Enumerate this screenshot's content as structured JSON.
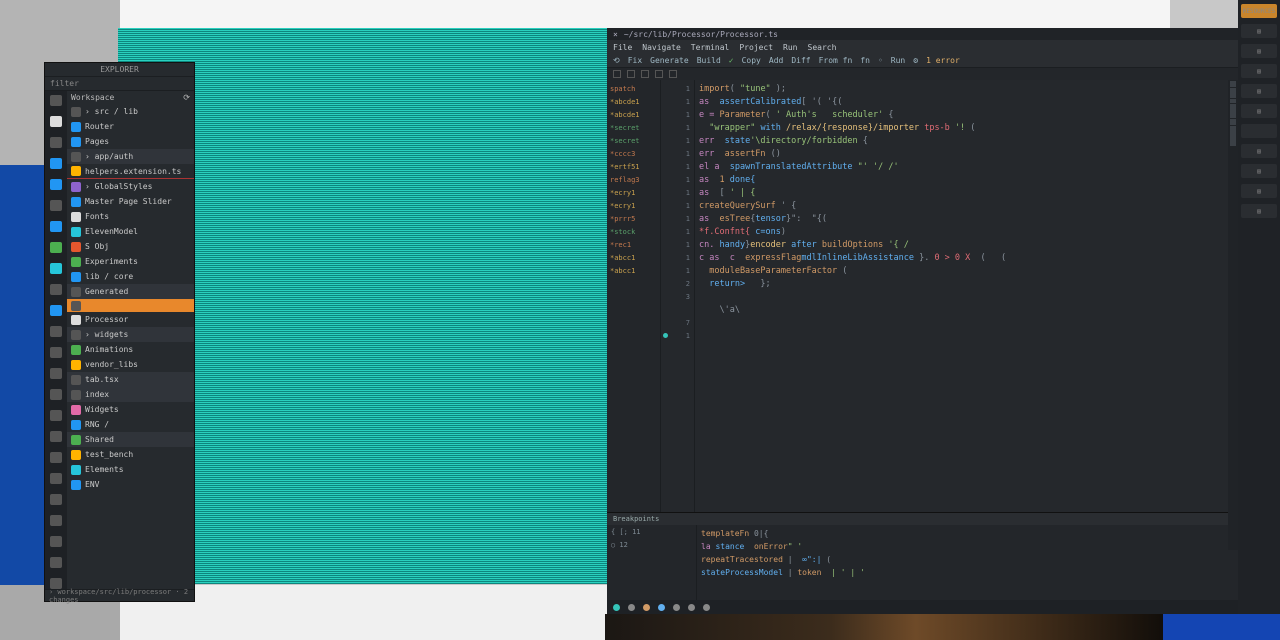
{
  "backdrop": {},
  "sidebar": {
    "title": "EXPLORER",
    "filter_placeholder": "filter",
    "tree_header": "Workspace",
    "items": [
      {
        "icon": "c-gy",
        "label": "› src / lib"
      },
      {
        "icon": "c-bl",
        "label": "Router"
      },
      {
        "icon": "c-bl",
        "label": "Pages"
      },
      {
        "icon": "c-gy",
        "label": "› app/auth",
        "variant": "dim"
      },
      {
        "icon": "c-yl",
        "label": "helpers.extension.ts",
        "variant": "err"
      },
      {
        "icon": "c-pu",
        "label": "› GlobalStyles"
      },
      {
        "icon": "c-bl",
        "label": "Master Page Slider"
      },
      {
        "icon": "c-wt",
        "label": "Fonts"
      },
      {
        "icon": "c-cy",
        "label": "ElevenModel"
      },
      {
        "icon": "c-rd",
        "label": "S Obj"
      },
      {
        "icon": "c-gr",
        "label": "Experiments"
      },
      {
        "icon": "c-bl",
        "label": "lib / core"
      },
      {
        "icon": "c-gy",
        "label": "Generated",
        "variant": "dim"
      },
      {
        "icon": "c-gy",
        "label": "",
        "variant": "sel"
      },
      {
        "icon": "c-wt",
        "label": "Processor"
      },
      {
        "icon": "c-gy",
        "label": "› widgets",
        "variant": "dim"
      },
      {
        "icon": "c-gr",
        "label": "Animations"
      },
      {
        "icon": "c-yl",
        "label": "vendor_libs"
      },
      {
        "icon": "c-gy",
        "label": "tab.tsx",
        "variant": "dim"
      },
      {
        "icon": "c-gy",
        "label": "index",
        "variant": "dim"
      },
      {
        "icon": "c-pk",
        "label": "Widgets"
      },
      {
        "icon": "c-bl",
        "label": "RNG /"
      },
      {
        "icon": "c-gr",
        "label": "Shared",
        "variant": "dim"
      },
      {
        "icon": "c-yl",
        "label": "test_bench"
      },
      {
        "icon": "c-cy",
        "label": "Elements"
      },
      {
        "icon": "c-bl",
        "label": "ENV"
      }
    ],
    "status": "› workspace/src/lib/processor · 2 changes"
  },
  "rail_icons": [
    "c-gy",
    "c-wt",
    "c-gy",
    "c-bl",
    "c-bl",
    "c-gy",
    "c-bl",
    "c-gr",
    "c-cy",
    "c-gy",
    "c-bl",
    "c-gy",
    "c-gy",
    "c-gy",
    "c-gy",
    "c-gy",
    "c-gy",
    "c-gy",
    "c-gy",
    "c-gy",
    "c-gy",
    "c-gy",
    "c-gy",
    "c-gy"
  ],
  "editor": {
    "tab_title": "~/src/lib/Processor/Processor.ts",
    "menus": [
      "File",
      "Navigate",
      "Terminal",
      "Project",
      "Run",
      "Search"
    ],
    "toolbar": [
      "⟲",
      "Fix",
      "Generate",
      "Build",
      "✓",
      "Copy",
      "Add",
      "Diff",
      "From fn",
      "fn",
      "◦",
      "Run",
      "⚙",
      "1 error"
    ],
    "breadcrumbs": [
      "□",
      "□",
      "□",
      "□",
      "□"
    ],
    "blame": [
      {
        "t": "spatch",
        "c": ""
      },
      {
        "t": "*abcde1",
        "c": "alt"
      },
      {
        "t": "*abcde1",
        "c": "alt"
      },
      {
        "t": "*secret",
        "c": "gr"
      },
      {
        "t": "*secret",
        "c": "gr"
      },
      {
        "t": "*cccc3",
        "c": ""
      },
      {
        "t": "*ertf51",
        "c": "alt"
      },
      {
        "t": "reflag3",
        "c": ""
      },
      {
        "t": "*ecry1",
        "c": "alt"
      },
      {
        "t": "*ecry1",
        "c": "alt"
      },
      {
        "t": "*prrr5",
        "c": ""
      },
      {
        "t": "*stock",
        "c": "gr"
      },
      {
        "t": "*rec1",
        "c": ""
      },
      {
        "t": "*abcc1",
        "c": "alt"
      },
      {
        "t": "*abcc1",
        "c": "alt"
      },
      {
        "t": "",
        "c": ""
      },
      {
        "t": "",
        "c": ""
      },
      {
        "t": "",
        "c": ""
      },
      {
        "t": "",
        "c": ""
      },
      {
        "t": "",
        "c": ""
      },
      {
        "t": "",
        "c": ""
      }
    ],
    "gutter": [
      "1",
      "1",
      "1",
      "1",
      "1",
      "1",
      "1",
      "1",
      "1",
      "1",
      "1",
      "1",
      "1",
      "1",
      "1",
      "2",
      "3",
      "",
      "7",
      "1",
      ""
    ],
    "gutter_marks": [
      19
    ],
    "code": [
      [
        [
          "tk-fn",
          "import"
        ],
        [
          "tk-punc",
          "( "
        ],
        [
          "tk-str",
          "\"tune\""
        ],
        [
          "tk-punc",
          " );"
        ]
      ],
      [
        [
          "tk-kw",
          "as  "
        ],
        [
          "tk-id",
          "assertCalibrated"
        ],
        [
          "tk-punc",
          "[ '( '{("
        ]
      ],
      [
        [
          "tk-kw",
          "e = "
        ],
        [
          "tk-fn",
          "Parameter"
        ],
        [
          "tk-punc",
          "( "
        ],
        [
          "tk-str",
          "' Auth's   scheduler'"
        ],
        [
          "tk-punc",
          " {"
        ]
      ],
      [
        [
          "tk-punc",
          "  "
        ],
        [
          "tk-str",
          "\"wrapper\" "
        ],
        [
          "tk-id",
          "with "
        ],
        [
          "tk-type",
          "/relax/{response}/importer "
        ],
        [
          "tk-err",
          "tps-b "
        ],
        [
          "tk-str",
          "'! "
        ],
        [
          "tk-punc",
          "("
        ]
      ],
      [
        [
          "tk-kw",
          "err  "
        ],
        [
          "tk-id",
          "state"
        ],
        [
          "tk-str",
          "'\\directory/forbidden "
        ],
        [
          "tk-punc",
          "{"
        ]
      ],
      [
        [
          "tk-kw",
          "err  "
        ],
        [
          "tk-fn",
          "assertFn "
        ],
        [
          "tk-punc",
          "()"
        ]
      ],
      [
        [
          "tk-kw",
          "el a  "
        ],
        [
          "tk-id",
          "spawnTranslatedAttribute "
        ],
        [
          "tk-str",
          "\"' '/ /'"
        ]
      ],
      [
        [
          "tk-kw",
          "as  "
        ],
        [
          "tk-num",
          "1 "
        ],
        [
          "tk-id",
          "done{"
        ]
      ],
      [
        [
          "tk-kw",
          "as  "
        ],
        [
          "tk-punc",
          "[ "
        ],
        [
          "tk-str",
          "' | {"
        ]
      ],
      [
        [
          "tk-fn",
          "createQuerySurf"
        ],
        [
          "tk-punc",
          " ' {"
        ]
      ],
      [
        [
          "tk-kw",
          "as  "
        ],
        [
          "tk-fn",
          "esTree"
        ],
        [
          "tk-punc",
          "{"
        ],
        [
          "tk-id",
          "tensor"
        ],
        [
          "tk-punc",
          "}\":  \"{("
        ]
      ],
      [
        [
          "tk-err",
          "*f.Confnt{ "
        ],
        [
          "tk-id",
          "c=ons"
        ],
        [
          "tk-punc",
          ")"
        ]
      ],
      [
        [
          "tk-kw",
          "cn. "
        ],
        [
          "tk-id",
          "handy"
        ],
        [
          "tk-punc",
          "}"
        ],
        [
          "tk-type",
          "encoder "
        ],
        [
          "tk-id",
          "after "
        ],
        [
          "tk-fn",
          "buildOptions "
        ],
        [
          "tk-str",
          "'{ /"
        ]
      ],
      [
        [
          "tk-kw",
          "c "
        ],
        [
          "tk-kw",
          "as  c  "
        ],
        [
          "tk-fn",
          "expressFlag"
        ],
        [
          "tk-id",
          "mdlInlineLibAssistance "
        ],
        [
          "tk-punc",
          "}. "
        ],
        [
          "tk-err",
          "0 > 0 X  "
        ],
        [
          "tk-punc",
          "(   ("
        ]
      ],
      [
        [
          "tk-fn",
          "  moduleBaseParameterFactor "
        ],
        [
          "tk-punc",
          "("
        ]
      ],
      [
        [
          "tk-id",
          "  return> "
        ],
        [
          "tk-punc",
          "  };"
        ]
      ],
      [
        []
      ],
      [
        [
          "tk-punc",
          "    \\'a\\"
        ]
      ],
      [
        []
      ],
      [
        []
      ],
      [
        []
      ]
    ],
    "terminal": {
      "tab": "Breakpoints",
      "gut": [
        "{ [; ",
        "○",
        "",
        ""
      ],
      "gut_nums": [
        "11",
        "12",
        "",
        ""
      ],
      "lines": [
        [
          [
            "tk-fn",
            "templateFn "
          ],
          [
            "tk-punc",
            "0|{"
          ]
        ],
        [
          [
            "tk-kw",
            "la "
          ],
          [
            "tk-id",
            "stance  "
          ],
          [
            "tk-fn",
            "onError"
          ],
          [
            "tk-str",
            "\" '"
          ]
        ],
        [
          [
            "tk-fn",
            "repeatTracestored"
          ],
          [
            "tk-punc",
            " |  "
          ],
          [
            "tk-id",
            "∞\":| "
          ],
          [
            "tk-punc",
            "("
          ]
        ],
        [
          [
            "tk-id",
            "stateProcessModel "
          ],
          [
            "tk-punc",
            "| "
          ],
          [
            "tk-fn",
            "token "
          ],
          [
            "tk-str",
            " | ' | '"
          ]
        ]
      ]
    },
    "statusbar": {
      "items": [
        "●",
        "□",
        "⎇",
        "◆",
        "◇",
        "▣",
        "·"
      ]
    }
  },
  "right_strip": [
    "RESOURCES",
    "▤",
    "▤",
    "▤",
    "▤",
    "▤",
    "",
    "▤",
    "▤",
    "▤",
    "▤"
  ]
}
